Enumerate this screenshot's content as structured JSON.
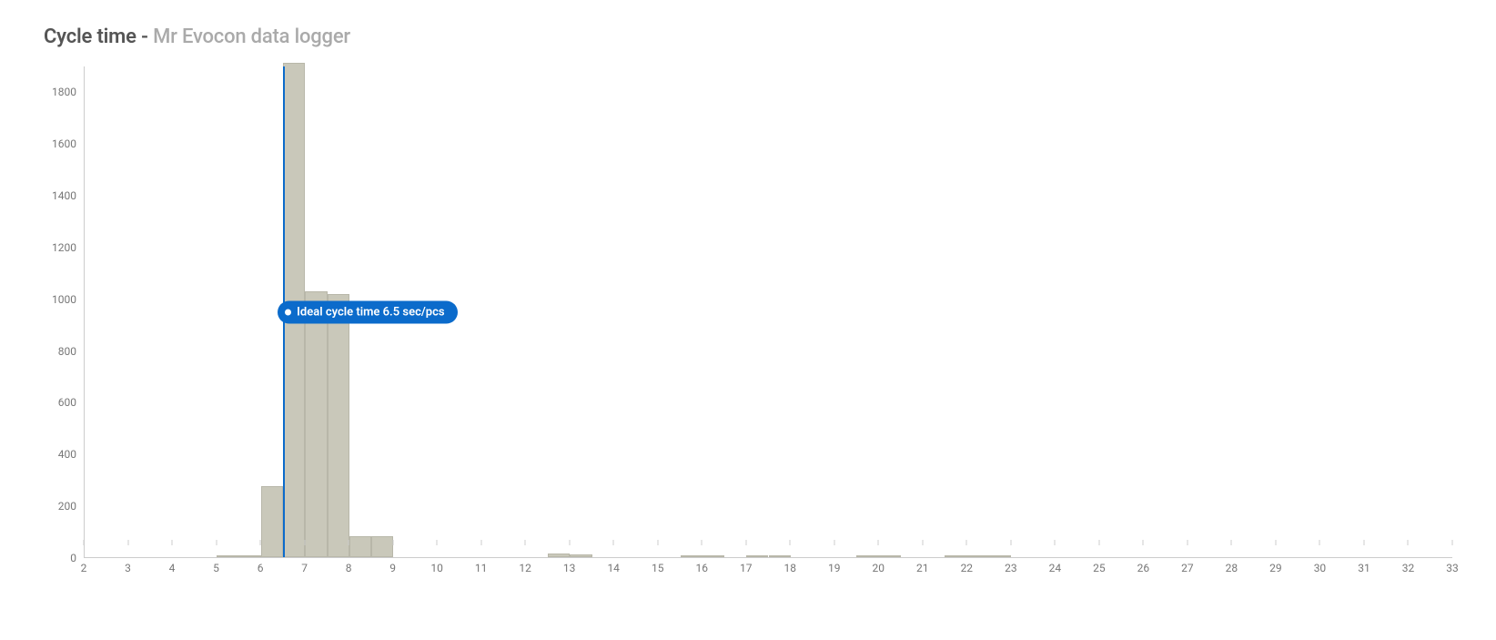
{
  "title": {
    "main": "Cycle time",
    "separator": " - ",
    "sub": "Mr Evocon data logger"
  },
  "chart_data": {
    "type": "bar",
    "title": "Cycle time - Mr Evocon data logger",
    "xlabel": "",
    "ylabel": "",
    "xlim": [
      2,
      33
    ],
    "ylim": [
      0,
      1900
    ],
    "x_ticks": [
      2,
      3,
      4,
      5,
      6,
      7,
      8,
      9,
      10,
      11,
      12,
      13,
      14,
      15,
      16,
      17,
      18,
      19,
      20,
      21,
      22,
      23,
      24,
      25,
      26,
      27,
      28,
      29,
      30,
      31,
      32,
      33
    ],
    "y_ticks": [
      0,
      200,
      400,
      600,
      800,
      1000,
      1200,
      1400,
      1600,
      1800
    ],
    "bins": [
      {
        "start": 5,
        "end": 5.5,
        "value": 3
      },
      {
        "start": 5.5,
        "end": 6,
        "value": 5
      },
      {
        "start": 6,
        "end": 6.5,
        "value": 275
      },
      {
        "start": 6.5,
        "end": 7,
        "value": 1915
      },
      {
        "start": 7,
        "end": 7.5,
        "value": 1030
      },
      {
        "start": 7.5,
        "end": 8,
        "value": 1020
      },
      {
        "start": 8,
        "end": 8.5,
        "value": 80
      },
      {
        "start": 8.5,
        "end": 9,
        "value": 80
      },
      {
        "start": 12.5,
        "end": 13,
        "value": 14
      },
      {
        "start": 13,
        "end": 13.5,
        "value": 12
      },
      {
        "start": 15.5,
        "end": 16,
        "value": 6
      },
      {
        "start": 16,
        "end": 16.5,
        "value": 6
      },
      {
        "start": 17,
        "end": 17.5,
        "value": 4
      },
      {
        "start": 17.5,
        "end": 18,
        "value": 4
      },
      {
        "start": 19.5,
        "end": 20,
        "value": 6
      },
      {
        "start": 20,
        "end": 20.5,
        "value": 6
      },
      {
        "start": 21.5,
        "end": 22,
        "value": 6
      },
      {
        "start": 22,
        "end": 22.5,
        "value": 4
      },
      {
        "start": 22.5,
        "end": 23,
        "value": 4
      }
    ],
    "reference_line": {
      "x": 6.5,
      "label": "Ideal cycle time 6.5 sec/pcs",
      "color": "#0B6BCB"
    }
  }
}
